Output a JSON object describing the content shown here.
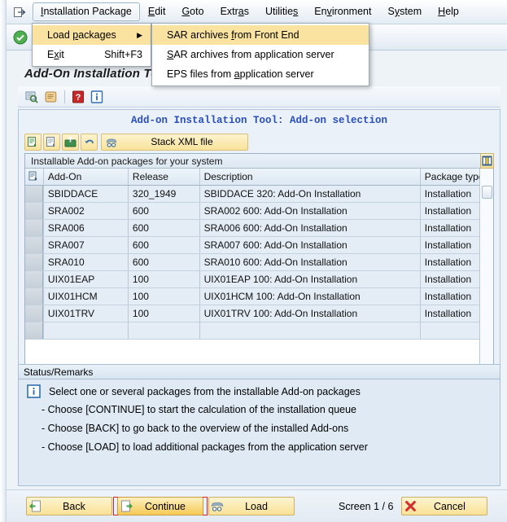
{
  "menubar": {
    "system_icon": "sap-system-menu-icon",
    "items": [
      {
        "label": "Installation Package",
        "accel": "I",
        "active": true
      },
      {
        "label": "Edit",
        "accel": "E",
        "active": false
      },
      {
        "label": "Goto",
        "accel": "G",
        "active": false
      },
      {
        "label": "Extras",
        "accel": "a",
        "active": false
      },
      {
        "label": "Utilities",
        "accel": "s",
        "active": false
      },
      {
        "label": "Environment",
        "accel": "v",
        "active": false
      },
      {
        "label": "System",
        "accel": "y",
        "active": false
      },
      {
        "label": "Help",
        "accel": "H",
        "active": false
      }
    ]
  },
  "menu_main": {
    "items": [
      {
        "label": "Load packages",
        "shortcut": "",
        "submenu": true,
        "highlight": true
      },
      {
        "label": "Exit",
        "shortcut": "Shift+F3",
        "submenu": false,
        "highlight": false
      }
    ]
  },
  "menu_sub": {
    "items": [
      {
        "label": "SAR archives from Front End",
        "highlight": true
      },
      {
        "label": "SAR archives from application server",
        "highlight": false
      },
      {
        "label": "EPS files from application server",
        "highlight": false
      }
    ]
  },
  "toolbar": {
    "icons": [
      "green-check-icon",
      "save-icon",
      "back-arrow-icon",
      "exit-up-icon",
      "cancel-x-icon",
      "print-icon",
      "find-icon",
      "find-next-icon",
      "first-page-icon",
      "previous-page-icon",
      "next-page-icon",
      "last-page-icon",
      "create-session-icon",
      "new-window-icon",
      "help-icon",
      "customize-layout-icon"
    ]
  },
  "screen": {
    "title": "Add-On Installation Tool",
    "sub_toolbar_icons": [
      "log-display-icon",
      "scroll-list-icon",
      "help-red-icon",
      "info-blue-icon"
    ],
    "tool_heading": "Add-on Installation Tool: Add-on selection"
  },
  "stack_toolbar": {
    "icons": [
      "select-all-icon",
      "deselect-all-icon",
      "load-from-front-end-icon",
      "undo-icon"
    ],
    "stack_xml_icon": "stack-xml-icon",
    "stack_xml_label": "Stack XML file"
  },
  "grid": {
    "caption": "Installable Add-on packages for your system",
    "select_header_icon": "select-column-icon",
    "layout_icon": "table-settings-icon",
    "columns": [
      "Add-On",
      "Release",
      "Description",
      "Package type"
    ],
    "rows": [
      {
        "addon": "SBIDDACE",
        "release": "320_1949",
        "description": "SBIDDACE 320: Add-On Installation",
        "package_type": "Installation"
      },
      {
        "addon": "SRA002",
        "release": "600",
        "description": "SRA002 600: Add-On Installation",
        "package_type": "Installation"
      },
      {
        "addon": "SRA006",
        "release": "600",
        "description": "SRA006 600: Add-On Installation",
        "package_type": "Installation"
      },
      {
        "addon": "SRA007",
        "release": "600",
        "description": "SRA007 600: Add-On Installation",
        "package_type": "Installation"
      },
      {
        "addon": "SRA010",
        "release": "600",
        "description": "SRA010 600: Add-On Installation",
        "package_type": "Installation"
      },
      {
        "addon": "UIX01EAP",
        "release": "100",
        "description": "UIX01EAP 100: Add-On Installation",
        "package_type": "Installation"
      },
      {
        "addon": "UIX01HCM",
        "release": "100",
        "description": "UIX01HCM 100: Add-On Installation",
        "package_type": "Installation"
      },
      {
        "addon": "UIX01TRV",
        "release": "100",
        "description": "UIX01TRV 100: Add-On Installation",
        "package_type": "Installation"
      },
      {
        "addon": "",
        "release": "",
        "description": "",
        "package_type": ""
      }
    ]
  },
  "status": {
    "title": "Status/Remarks",
    "info_icon": "info-icon",
    "main_line": "Select one or several packages from the installable Add-on packages",
    "bullets": [
      "- Choose [CONTINUE] to start the calculation of the installation queue",
      "- Choose [BACK] to go back to the overview of the installed Add-ons",
      "- Choose [LOAD] to load additional packages from the application server"
    ]
  },
  "footer": {
    "back_label": "Back",
    "back_icon": "back-page-icon",
    "continue_label": "Continue",
    "continue_icon": "forward-page-icon",
    "load_label": "Load",
    "load_icon": "load-glasses-icon",
    "screen_counter": "Screen 1 / 6",
    "cancel_label": "Cancel",
    "cancel_icon": "red-x-icon"
  },
  "colors": {
    "menu_highlight": "#fae3a0",
    "button_yellow": "#f9e296",
    "focus_red": "#e02020",
    "heading_blue": "#2a4fbb"
  }
}
